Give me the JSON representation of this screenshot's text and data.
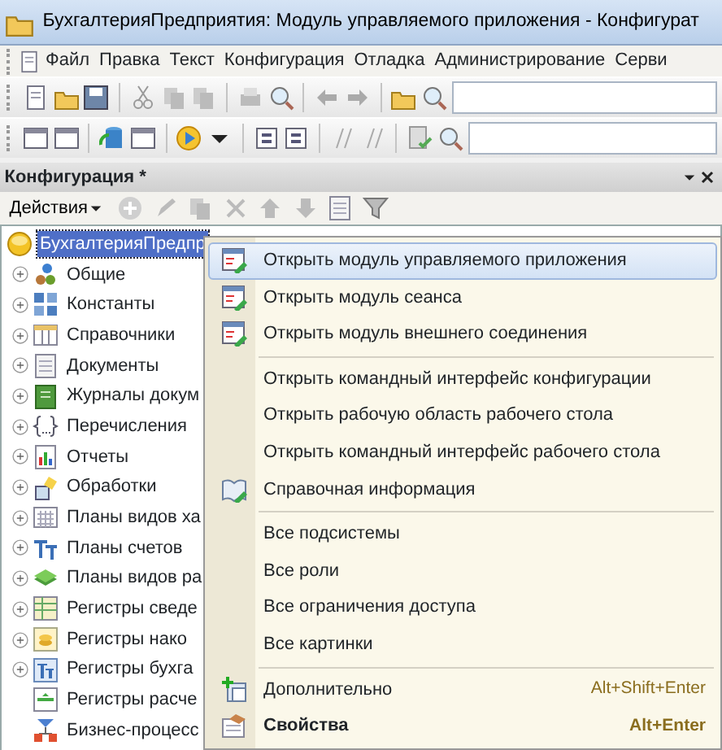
{
  "window": {
    "title": "БухгалтерияПредприятия: Модуль управляемого приложения - Конфигурат"
  },
  "menu_bar": [
    {
      "label": "Файл"
    },
    {
      "label": "Правка"
    },
    {
      "label": "Текст"
    },
    {
      "label": "Конфигурация"
    },
    {
      "label": "Отладка"
    },
    {
      "label": "Администрирование"
    },
    {
      "label": "Серви"
    }
  ],
  "panel": {
    "title": "Конфигурация *",
    "actions_label": "Действия"
  },
  "tree": {
    "label": "БухгалтерияПредпр",
    "selected": true,
    "children": [
      {
        "label": "Общие",
        "expandable": true,
        "selected": false
      },
      {
        "label": "Константы",
        "expandable": true,
        "selected": false
      },
      {
        "label": "Справочники",
        "expandable": true,
        "selected": false
      },
      {
        "label": "Документы",
        "expandable": true,
        "selected": false
      },
      {
        "label": "Журналы докум",
        "expandable": true,
        "selected": false
      },
      {
        "label": "Перечисления",
        "expandable": true,
        "selected": false
      },
      {
        "label": "Отчеты",
        "expandable": true,
        "selected": false
      },
      {
        "label": "Обработки",
        "expandable": true,
        "selected": false
      },
      {
        "label": "Планы видов ха",
        "expandable": true,
        "selected": false
      },
      {
        "label": "Планы счетов",
        "expandable": true,
        "selected": false
      },
      {
        "label": "Планы видов ра",
        "expandable": true,
        "selected": false
      },
      {
        "label": "Регистры сведе",
        "expandable": true,
        "selected": false
      },
      {
        "label": "Регистры нако",
        "expandable": true,
        "selected": false
      },
      {
        "label": "Регистры бухга",
        "expandable": true,
        "selected": false
      },
      {
        "label": "Регистры расче",
        "expandable": false,
        "selected": false
      },
      {
        "label": "Бизнес-процесс",
        "expandable": false,
        "selected": false
      }
    ]
  },
  "context_menu": [
    {
      "kind": "item",
      "label": "Открыть модуль управляемого приложения",
      "selected": true,
      "default": false
    },
    {
      "kind": "item",
      "label": "Открыть модуль сеанса",
      "selected": false,
      "default": false
    },
    {
      "kind": "item",
      "label": "Открыть модуль внешнего соединения",
      "selected": false,
      "default": false
    },
    {
      "kind": "separator"
    },
    {
      "kind": "item",
      "label": "Открыть командный интерфейс конфигурации",
      "selected": false,
      "default": false
    },
    {
      "kind": "item",
      "label": "Открыть рабочую область рабочего стола",
      "selected": false,
      "default": false
    },
    {
      "kind": "item",
      "label": "Открыть командный интерфейс рабочего стола",
      "selected": false,
      "default": false
    },
    {
      "kind": "item",
      "label": "Справочная информация",
      "selected": false,
      "default": false
    },
    {
      "kind": "separator"
    },
    {
      "kind": "item",
      "label": "Все подсистемы",
      "selected": false,
      "default": false
    },
    {
      "kind": "item",
      "label": "Все роли",
      "selected": false,
      "default": false
    },
    {
      "kind": "item",
      "label": "Все ограничения доступа",
      "selected": false,
      "default": false
    },
    {
      "kind": "item",
      "label": "Все картинки",
      "selected": false,
      "default": false
    },
    {
      "kind": "separator"
    },
    {
      "kind": "item",
      "label": "Дополнительно",
      "shortcut": "Alt+Shift+Enter",
      "selected": false,
      "default": false
    },
    {
      "kind": "item",
      "label": "Свойства",
      "shortcut": "Alt+Enter",
      "selected": false,
      "default": true
    }
  ]
}
